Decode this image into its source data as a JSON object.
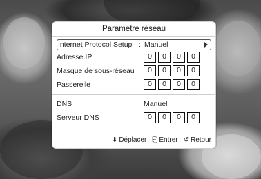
{
  "dialog": {
    "title": "Paramètre réseau",
    "rows": {
      "protocol": {
        "label": "Internet Protocol Setup",
        "value": "Manuel"
      },
      "ip": {
        "label": "Adresse IP",
        "octets": [
          "0",
          "0",
          "0",
          "0"
        ]
      },
      "mask": {
        "label": "Masque de sous-réseau",
        "octets": [
          "0",
          "0",
          "0",
          "0"
        ]
      },
      "gateway": {
        "label": "Passerelle",
        "octets": [
          "0",
          "0",
          "0",
          "0"
        ]
      },
      "dns": {
        "label": "DNS",
        "value": "Manuel"
      },
      "dns_server": {
        "label": "Serveur DNS",
        "octets": [
          "0",
          "0",
          "0",
          "0"
        ]
      }
    },
    "colon": ":",
    "footer": {
      "move": {
        "icon": "up-down-arrows-icon",
        "glyph": "⬍",
        "label": "Déplacer"
      },
      "enter": {
        "icon": "enter-icon",
        "glyph": "⎘",
        "label": "Entrer"
      },
      "back": {
        "icon": "return-icon",
        "glyph": "↺",
        "label": "Retour"
      }
    }
  },
  "colors": {
    "panel_bg": "#ffffff",
    "selected_border": "#555555",
    "box_border": "#111111"
  }
}
